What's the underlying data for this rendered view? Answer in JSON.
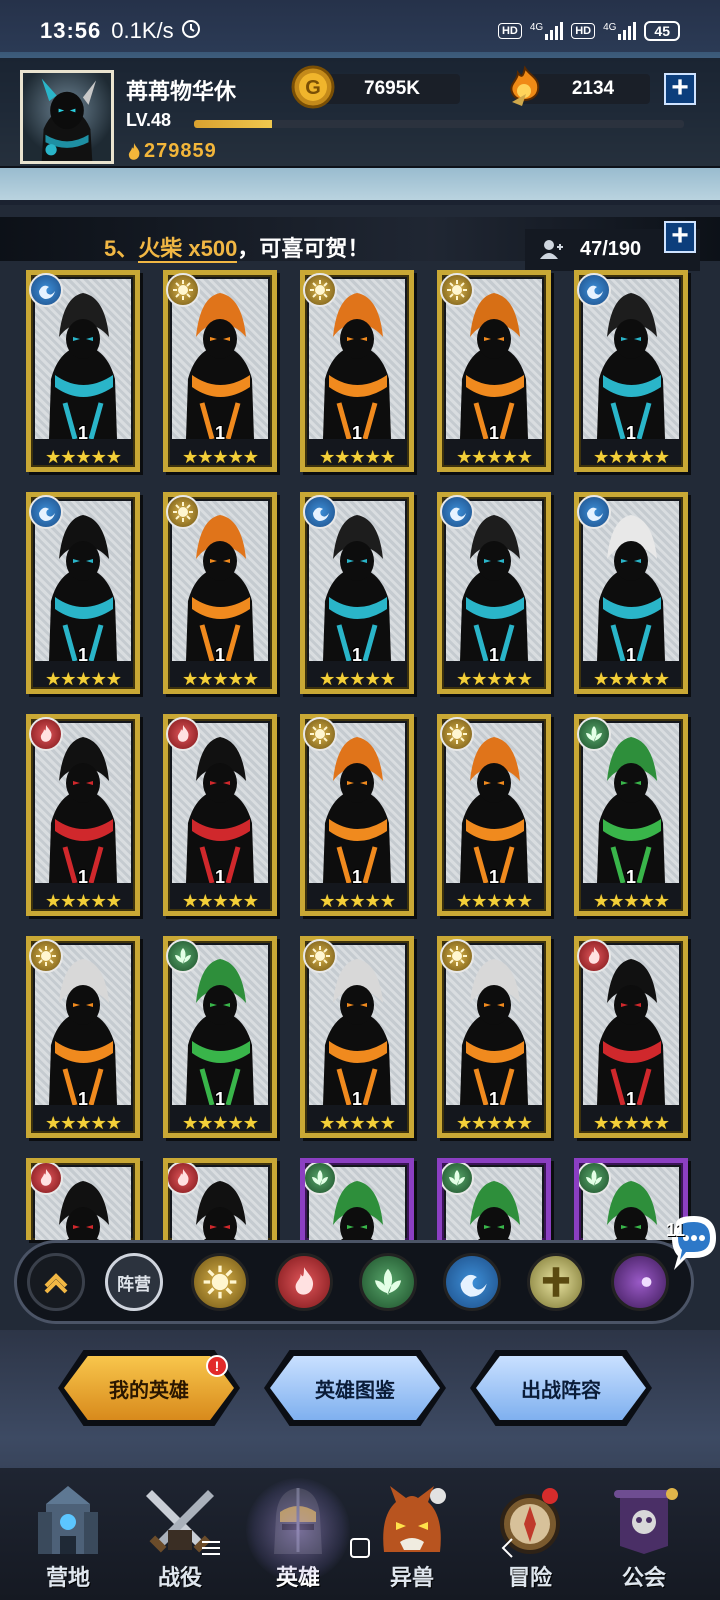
{
  "status_bar": {
    "time": "13:56",
    "speed": "0.1K/s",
    "sim1_label": "HD",
    "sim1_net": "4G",
    "sim2_label": "HD",
    "sim2_net": "4G",
    "battery": "45"
  },
  "profile": {
    "name": "苒苒物华休",
    "level": "LV.48",
    "xp_fraction": 0.16,
    "power": "279859"
  },
  "currencies": {
    "gold": "7695K",
    "gems": "2134"
  },
  "notice": {
    "prefix": "5、",
    "item": "火柴 x500",
    "suffix": "，可喜可贺！"
  },
  "hero_count": "47/190",
  "colors": {
    "gold_frame": "#c9a835",
    "purple_frame": "#8b3fc2",
    "star": "#f3cf39",
    "accent_orange": "#f1b744"
  },
  "heroes": [
    {
      "faction": "water",
      "level": "1",
      "stars": "★★★★★",
      "rarity": "gold",
      "look": "cyan"
    },
    {
      "faction": "light",
      "level": "1",
      "stars": "★★★★★",
      "rarity": "gold",
      "look": "orange-hood"
    },
    {
      "faction": "light",
      "level": "1",
      "stars": "★★★★★",
      "rarity": "gold",
      "look": "orange-hood"
    },
    {
      "faction": "light",
      "level": "1",
      "stars": "★★★★★",
      "rarity": "gold",
      "look": "orange-beard"
    },
    {
      "faction": "water",
      "level": "1",
      "stars": "★★★★★",
      "rarity": "gold",
      "look": "cyan"
    },
    {
      "faction": "water",
      "level": "1",
      "stars": "★★★★★",
      "rarity": "gold",
      "look": "cyan-jester"
    },
    {
      "faction": "light",
      "level": "1",
      "stars": "★★★★★",
      "rarity": "gold",
      "look": "orange-hood"
    },
    {
      "faction": "water",
      "level": "1",
      "stars": "★★★★★",
      "rarity": "gold",
      "look": "cyan"
    },
    {
      "faction": "water",
      "level": "1",
      "stars": "★★★★★",
      "rarity": "gold",
      "look": "cyan"
    },
    {
      "faction": "water",
      "level": "1",
      "stars": "★★★★★",
      "rarity": "gold",
      "look": "cyan-white"
    },
    {
      "faction": "fire",
      "level": "1",
      "stars": "★★★★★",
      "rarity": "gold",
      "look": "red-beast"
    },
    {
      "faction": "fire",
      "level": "1",
      "stars": "★★★★★",
      "rarity": "gold",
      "look": "red-beast"
    },
    {
      "faction": "light",
      "level": "1",
      "stars": "★★★★★",
      "rarity": "gold",
      "look": "orange-hood"
    },
    {
      "faction": "light",
      "level": "1",
      "stars": "★★★★★",
      "rarity": "gold",
      "look": "orange-hood"
    },
    {
      "faction": "nature",
      "level": "1",
      "stars": "★★★★★",
      "rarity": "gold",
      "look": "green"
    },
    {
      "faction": "light",
      "level": "1",
      "stars": "★★★★★",
      "rarity": "gold",
      "look": "orange-white"
    },
    {
      "faction": "nature",
      "level": "1",
      "stars": "★★★★★",
      "rarity": "gold",
      "look": "green"
    },
    {
      "faction": "light",
      "level": "1",
      "stars": "★★★★★",
      "rarity": "gold",
      "look": "orange-white"
    },
    {
      "faction": "light",
      "level": "1",
      "stars": "★★★★★",
      "rarity": "gold",
      "look": "orange-white"
    },
    {
      "faction": "fire",
      "level": "1",
      "stars": "★★★★★",
      "rarity": "gold",
      "look": "red-beast"
    },
    {
      "faction": "fire",
      "level": "",
      "stars": "",
      "rarity": "gold",
      "look": "red-beast"
    },
    {
      "faction": "fire",
      "level": "",
      "stars": "",
      "rarity": "gold",
      "look": "red-beast"
    },
    {
      "faction": "nature",
      "level": "",
      "stars": "",
      "rarity": "purple",
      "look": "green"
    },
    {
      "faction": "nature",
      "level": "",
      "stars": "",
      "rarity": "purple",
      "look": "green"
    },
    {
      "faction": "nature",
      "level": "",
      "stars": "",
      "rarity": "purple",
      "look": "green"
    }
  ],
  "filters": {
    "camp_label": "阵营",
    "items": [
      "collapse",
      "camp",
      "light",
      "fire",
      "nature",
      "water",
      "holy",
      "dark"
    ]
  },
  "chat_badge": "11",
  "tabs": {
    "my_heroes": "我的英雄",
    "hero_codex": "英雄图鉴",
    "battle_lineup": "出战阵容",
    "alert": "!"
  },
  "nav": {
    "camp": "营地",
    "campaign": "战役",
    "heroes": "英雄",
    "beasts": "异兽",
    "adventure": "冒险",
    "guild": "公会"
  }
}
